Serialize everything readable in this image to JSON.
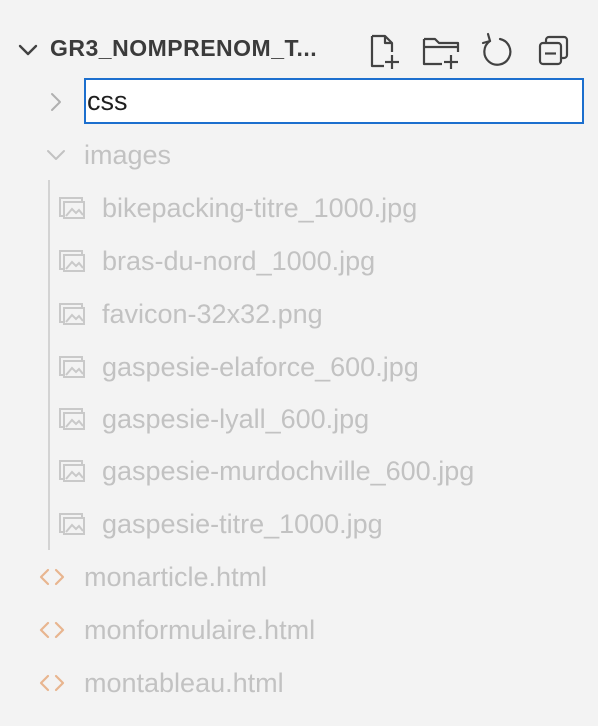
{
  "explorer": {
    "folder_title": "GR3_NOMPRENOM_T...",
    "actions": {
      "new_file": "new-file-icon",
      "new_folder": "new-folder-icon",
      "refresh": "refresh-icon",
      "collapse": "collapse-all-icon"
    },
    "rename_value": "css",
    "tree": {
      "images_folder": "images",
      "images": [
        "bikepacking-titre_1000.jpg",
        "bras-du-nord_1000.jpg",
        "favicon-32x32.png",
        "gaspesie-elaforce_600.jpg",
        "gaspesie-lyall_600.jpg",
        "gaspesie-murdochville_600.jpg",
        "gaspesie-titre_1000.jpg"
      ],
      "html_files": [
        "monarticle.html",
        "monformulaire.html",
        "montableau.html"
      ]
    },
    "colors": {
      "background": "#f3f3f3",
      "focus_border": "#1c6fce",
      "dimmed_text": "#c2c2c2",
      "html_icon": "#e8a87c"
    }
  }
}
